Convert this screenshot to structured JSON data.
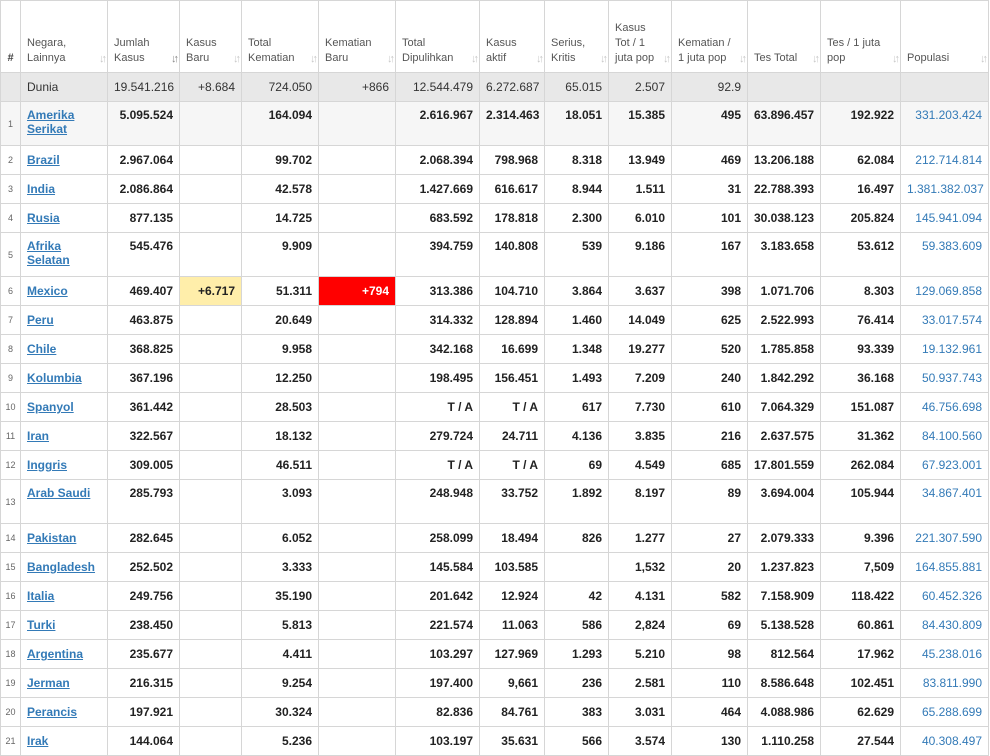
{
  "headers": [
    {
      "label": "#",
      "key": "index"
    },
    {
      "label": "Negara, Lainnya",
      "key": "country"
    },
    {
      "label": "Jumlah Kasus",
      "key": "total_cases"
    },
    {
      "label": "Kasus Baru",
      "key": "new_cases"
    },
    {
      "label": "Total Kematian",
      "key": "total_deaths"
    },
    {
      "label": "Kematian Baru",
      "key": "new_deaths"
    },
    {
      "label": "Total Dipulihkan",
      "key": "total_recovered"
    },
    {
      "label": "Kasus aktif",
      "key": "active_cases"
    },
    {
      "label": "Serius, Kritis",
      "key": "serious_critical"
    },
    {
      "label": "Kasus Tot / 1 juta pop",
      "key": "cases_per_million"
    },
    {
      "label": "Kematian / 1 juta pop",
      "key": "deaths_per_million"
    },
    {
      "label": "Tes Total",
      "key": "total_tests"
    },
    {
      "label": "Tes / 1 juta pop",
      "key": "tests_per_million"
    },
    {
      "label": "Populasi",
      "key": "population"
    }
  ],
  "sort_icon": "sort-arrows-icon",
  "active_sort_column": "total_cases",
  "world": {
    "name": "Dunia",
    "total_cases": "19.541.216",
    "new_cases": "+8.684",
    "total_deaths": "724.050",
    "new_deaths": "+866",
    "total_recovered": "12.544.479",
    "active_cases": "6.272.687",
    "serious_critical": "65.015",
    "cases_per_million": "2.507",
    "deaths_per_million": "92.9",
    "total_tests": "",
    "tests_per_million": "",
    "population": ""
  },
  "rows": [
    {
      "index": "1",
      "name": "Amerika Serikat",
      "total_cases": "5.095.524",
      "new_cases": "",
      "total_deaths": "164.094",
      "new_deaths": "",
      "total_recovered": "2.616.967",
      "active_cases": "2.314.463",
      "serious_critical": "18.051",
      "cases_per_million": "15.385",
      "deaths_per_million": "495",
      "total_tests": "63.896.457",
      "tests_per_million": "192.922",
      "population": "331.203.424"
    },
    {
      "index": "2",
      "name": "Brazil",
      "total_cases": "2.967.064",
      "new_cases": "",
      "total_deaths": "99.702",
      "new_deaths": "",
      "total_recovered": "2.068.394",
      "active_cases": "798.968",
      "serious_critical": "8.318",
      "cases_per_million": "13.949",
      "deaths_per_million": "469",
      "total_tests": "13.206.188",
      "tests_per_million": "62.084",
      "population": "212.714.814"
    },
    {
      "index": "3",
      "name": "India",
      "total_cases": "2.086.864",
      "new_cases": "",
      "total_deaths": "42.578",
      "new_deaths": "",
      "total_recovered": "1.427.669",
      "active_cases": "616.617",
      "serious_critical": "8.944",
      "cases_per_million": "1.511",
      "deaths_per_million": "31",
      "total_tests": "22.788.393",
      "tests_per_million": "16.497",
      "population": "1.381.382.037"
    },
    {
      "index": "4",
      "name": "Rusia",
      "total_cases": "877.135",
      "new_cases": "",
      "total_deaths": "14.725",
      "new_deaths": "",
      "total_recovered": "683.592",
      "active_cases": "178.818",
      "serious_critical": "2.300",
      "cases_per_million": "6.010",
      "deaths_per_million": "101",
      "total_tests": "30.038.123",
      "tests_per_million": "205.824",
      "population": "145.941.094"
    },
    {
      "index": "5",
      "name": "Afrika Selatan",
      "total_cases": "545.476",
      "new_cases": "",
      "total_deaths": "9.909",
      "new_deaths": "",
      "total_recovered": "394.759",
      "active_cases": "140.808",
      "serious_critical": "539",
      "cases_per_million": "9.186",
      "deaths_per_million": "167",
      "total_tests": "3.183.658",
      "tests_per_million": "53.612",
      "population": "59.383.609"
    },
    {
      "index": "6",
      "name": "Mexico",
      "total_cases": "469.407",
      "new_cases": "+6.717",
      "total_deaths": "51.311",
      "new_deaths": "+794",
      "total_recovered": "313.386",
      "active_cases": "104.710",
      "serious_critical": "3.864",
      "cases_per_million": "3.637",
      "deaths_per_million": "398",
      "total_tests": "1.071.706",
      "tests_per_million": "8.303",
      "population": "129.069.858"
    },
    {
      "index": "7",
      "name": "Peru",
      "total_cases": "463.875",
      "new_cases": "",
      "total_deaths": "20.649",
      "new_deaths": "",
      "total_recovered": "314.332",
      "active_cases": "128.894",
      "serious_critical": "1.460",
      "cases_per_million": "14.049",
      "deaths_per_million": "625",
      "total_tests": "2.522.993",
      "tests_per_million": "76.414",
      "population": "33.017.574"
    },
    {
      "index": "8",
      "name": "Chile",
      "total_cases": "368.825",
      "new_cases": "",
      "total_deaths": "9.958",
      "new_deaths": "",
      "total_recovered": "342.168",
      "active_cases": "16.699",
      "serious_critical": "1.348",
      "cases_per_million": "19.277",
      "deaths_per_million": "520",
      "total_tests": "1.785.858",
      "tests_per_million": "93.339",
      "population": "19.132.961"
    },
    {
      "index": "9",
      "name": "Kolumbia",
      "total_cases": "367.196",
      "new_cases": "",
      "total_deaths": "12.250",
      "new_deaths": "",
      "total_recovered": "198.495",
      "active_cases": "156.451",
      "serious_critical": "1.493",
      "cases_per_million": "7.209",
      "deaths_per_million": "240",
      "total_tests": "1.842.292",
      "tests_per_million": "36.168",
      "population": "50.937.743"
    },
    {
      "index": "10",
      "name": "Spanyol",
      "total_cases": "361.442",
      "new_cases": "",
      "total_deaths": "28.503",
      "new_deaths": "",
      "total_recovered": "T / A",
      "active_cases": "T / A",
      "serious_critical": "617",
      "cases_per_million": "7.730",
      "deaths_per_million": "610",
      "total_tests": "7.064.329",
      "tests_per_million": "151.087",
      "population": "46.756.698"
    },
    {
      "index": "11",
      "name": "Iran",
      "total_cases": "322.567",
      "new_cases": "",
      "total_deaths": "18.132",
      "new_deaths": "",
      "total_recovered": "279.724",
      "active_cases": "24.711",
      "serious_critical": "4.136",
      "cases_per_million": "3.835",
      "deaths_per_million": "216",
      "total_tests": "2.637.575",
      "tests_per_million": "31.362",
      "population": "84.100.560"
    },
    {
      "index": "12",
      "name": "Inggris",
      "total_cases": "309.005",
      "new_cases": "",
      "total_deaths": "46.511",
      "new_deaths": "",
      "total_recovered": "T / A",
      "active_cases": "T / A",
      "serious_critical": "69",
      "cases_per_million": "4.549",
      "deaths_per_million": "685",
      "total_tests": "17.801.559",
      "tests_per_million": "262.084",
      "population": "67.923.001"
    },
    {
      "index": "13",
      "name": "Arab Saudi",
      "total_cases": "285.793",
      "new_cases": "",
      "total_deaths": "3.093",
      "new_deaths": "",
      "total_recovered": "248.948",
      "active_cases": "33.752",
      "serious_critical": "1.892",
      "cases_per_million": "8.197",
      "deaths_per_million": "89",
      "total_tests": "3.694.004",
      "tests_per_million": "105.944",
      "population": "34.867.401"
    },
    {
      "index": "14",
      "name": "Pakistan",
      "total_cases": "282.645",
      "new_cases": "",
      "total_deaths": "6.052",
      "new_deaths": "",
      "total_recovered": "258.099",
      "active_cases": "18.494",
      "serious_critical": "826",
      "cases_per_million": "1.277",
      "deaths_per_million": "27",
      "total_tests": "2.079.333",
      "tests_per_million": "9.396",
      "population": "221.307.590"
    },
    {
      "index": "15",
      "name": "Bangladesh",
      "total_cases": "252.502",
      "new_cases": "",
      "total_deaths": "3.333",
      "new_deaths": "",
      "total_recovered": "145.584",
      "active_cases": "103.585",
      "serious_critical": "",
      "cases_per_million": "1,532",
      "deaths_per_million": "20",
      "total_tests": "1.237.823",
      "tests_per_million": "7,509",
      "population": "164.855.881"
    },
    {
      "index": "16",
      "name": "Italia",
      "total_cases": "249.756",
      "new_cases": "",
      "total_deaths": "35.190",
      "new_deaths": "",
      "total_recovered": "201.642",
      "active_cases": "12.924",
      "serious_critical": "42",
      "cases_per_million": "4.131",
      "deaths_per_million": "582",
      "total_tests": "7.158.909",
      "tests_per_million": "118.422",
      "population": "60.452.326"
    },
    {
      "index": "17",
      "name": "Turki",
      "total_cases": "238.450",
      "new_cases": "",
      "total_deaths": "5.813",
      "new_deaths": "",
      "total_recovered": "221.574",
      "active_cases": "11.063",
      "serious_critical": "586",
      "cases_per_million": "2,824",
      "deaths_per_million": "69",
      "total_tests": "5.138.528",
      "tests_per_million": "60.861",
      "population": "84.430.809"
    },
    {
      "index": "18",
      "name": "Argentina",
      "total_cases": "235.677",
      "new_cases": "",
      "total_deaths": "4.411",
      "new_deaths": "",
      "total_recovered": "103.297",
      "active_cases": "127.969",
      "serious_critical": "1.293",
      "cases_per_million": "5.210",
      "deaths_per_million": "98",
      "total_tests": "812.564",
      "tests_per_million": "17.962",
      "population": "45.238.016"
    },
    {
      "index": "19",
      "name": "Jerman",
      "total_cases": "216.315",
      "new_cases": "",
      "total_deaths": "9.254",
      "new_deaths": "",
      "total_recovered": "197.400",
      "active_cases": "9,661",
      "serious_critical": "236",
      "cases_per_million": "2.581",
      "deaths_per_million": "110",
      "total_tests": "8.586.648",
      "tests_per_million": "102.451",
      "population": "83.811.990"
    },
    {
      "index": "20",
      "name": "Perancis",
      "total_cases": "197.921",
      "new_cases": "",
      "total_deaths": "30.324",
      "new_deaths": "",
      "total_recovered": "82.836",
      "active_cases": "84.761",
      "serious_critical": "383",
      "cases_per_million": "3.031",
      "deaths_per_million": "464",
      "total_tests": "4.088.986",
      "tests_per_million": "62.629",
      "population": "65.288.699"
    },
    {
      "index": "21",
      "name": "Irak",
      "total_cases": "144.064",
      "new_cases": "",
      "total_deaths": "5.236",
      "new_deaths": "",
      "total_recovered": "103.197",
      "active_cases": "35.631",
      "serious_critical": "566",
      "cases_per_million": "3.574",
      "deaths_per_million": "130",
      "total_tests": "1.110.258",
      "tests_per_million": "27.544",
      "population": "40.308.497"
    }
  ],
  "colors": {
    "link": "#337ab7",
    "new_cases_highlight": "#ffeeaa",
    "new_deaths_highlight": "#ff0000",
    "world_row": "#e8e8e8"
  }
}
